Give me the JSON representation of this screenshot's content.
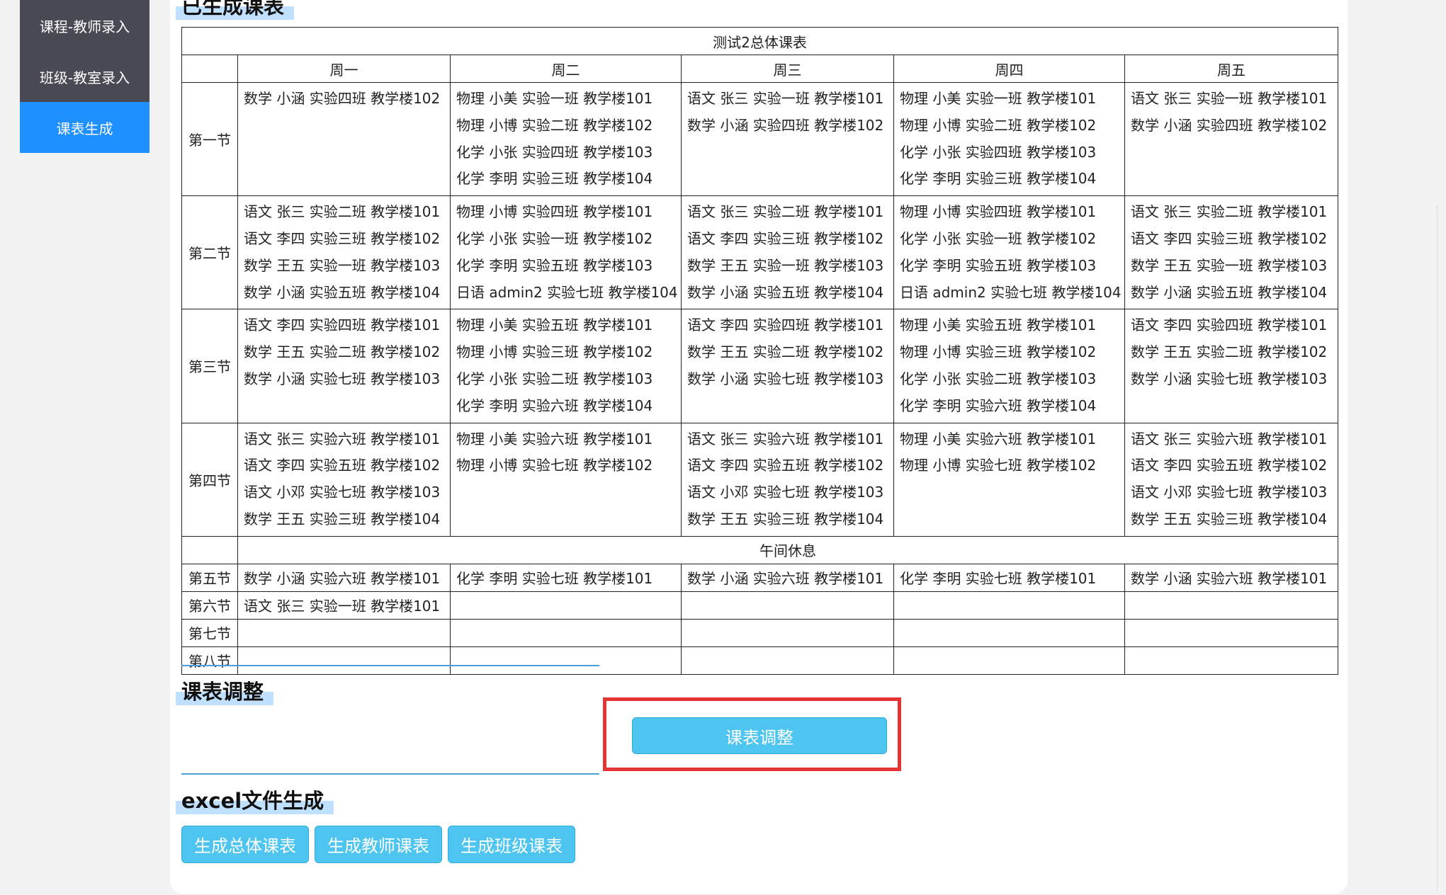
{
  "sidebar": {
    "items": [
      {
        "label": "课程-教师录入"
      },
      {
        "label": "班级-教室录入"
      },
      {
        "label": "课表生成"
      }
    ]
  },
  "generated": {
    "title": "已生成课表",
    "table_title": "测试2总体课表",
    "days": [
      "周一",
      "周二",
      "周三",
      "周四",
      "周五"
    ],
    "lunch_break": "午间休息",
    "morning": [
      {
        "period": "第一节",
        "cells": [
          [
            "数学 小涵 实验四班 教学楼102"
          ],
          [
            "物理 小美 实验一班 教学楼101",
            "物理 小博 实验二班 教学楼102",
            "化学 小张 实验四班 教学楼103",
            "化学 李明 实验三班 教学楼104"
          ],
          [
            "语文 张三 实验一班 教学楼101",
            "数学 小涵 实验四班 教学楼102"
          ],
          [
            "物理 小美 实验一班 教学楼101",
            "物理 小博 实验二班 教学楼102",
            "化学 小张 实验四班 教学楼103",
            "化学 李明 实验三班 教学楼104"
          ],
          [
            "语文 张三 实验一班 教学楼101",
            "数学 小涵 实验四班 教学楼102"
          ]
        ]
      },
      {
        "period": "第二节",
        "cells": [
          [
            "语文 张三 实验二班 教学楼101",
            "语文 李四 实验三班 教学楼102",
            "数学 王五 实验一班 教学楼103",
            "数学 小涵 实验五班 教学楼104"
          ],
          [
            "物理 小博 实验四班 教学楼101",
            "化学 小张 实验一班 教学楼102",
            "化学 李明 实验五班 教学楼103",
            "日语 admin2 实验七班 教学楼104"
          ],
          [
            "语文 张三 实验二班 教学楼101",
            "语文 李四 实验三班 教学楼102",
            "数学 王五 实验一班 教学楼103",
            "数学 小涵 实验五班 教学楼104"
          ],
          [
            "物理 小博 实验四班 教学楼101",
            "化学 小张 实验一班 教学楼102",
            "化学 李明 实验五班 教学楼103",
            "日语 admin2 实验七班 教学楼104"
          ],
          [
            "语文 张三 实验二班 教学楼101",
            "语文 李四 实验三班 教学楼102",
            "数学 王五 实验一班 教学楼103",
            "数学 小涵 实验五班 教学楼104"
          ]
        ]
      },
      {
        "period": "第三节",
        "cells": [
          [
            "语文 李四 实验四班 教学楼101",
            "数学 王五 实验二班 教学楼102",
            "数学 小涵 实验七班 教学楼103"
          ],
          [
            "物理 小美 实验五班 教学楼101",
            "物理 小博 实验三班 教学楼102",
            "化学 小张 实验二班 教学楼103",
            "化学 李明 实验六班 教学楼104"
          ],
          [
            "语文 李四 实验四班 教学楼101",
            "数学 王五 实验二班 教学楼102",
            "数学 小涵 实验七班 教学楼103"
          ],
          [
            "物理 小美 实验五班 教学楼101",
            "物理 小博 实验三班 教学楼102",
            "化学 小张 实验二班 教学楼103",
            "化学 李明 实验六班 教学楼104"
          ],
          [
            "语文 李四 实验四班 教学楼101",
            "数学 王五 实验二班 教学楼102",
            "数学 小涵 实验七班 教学楼103"
          ]
        ]
      },
      {
        "period": "第四节",
        "cells": [
          [
            "语文 张三 实验六班 教学楼101",
            "语文 李四 实验五班 教学楼102",
            "语文 小邓 实验七班 教学楼103",
            "数学 王五 实验三班 教学楼104"
          ],
          [
            "物理 小美 实验六班 教学楼101",
            "物理 小博 实验七班 教学楼102"
          ],
          [
            "语文 张三 实验六班 教学楼101",
            "语文 李四 实验五班 教学楼102",
            "语文 小邓 实验七班 教学楼103",
            "数学 王五 实验三班 教学楼104"
          ],
          [
            "物理 小美 实验六班 教学楼101",
            "物理 小博 实验七班 教学楼102"
          ],
          [
            "语文 张三 实验六班 教学楼101",
            "语文 李四 实验五班 教学楼102",
            "语文 小邓 实验七班 教学楼103",
            "数学 王五 实验三班 教学楼104"
          ]
        ]
      }
    ],
    "afternoon": [
      {
        "period": "第五节",
        "cells": [
          "数学 小涵 实验六班 教学楼101",
          "化学 李明 实验七班 教学楼101",
          "数学 小涵 实验六班 教学楼101",
          "化学 李明 实验七班 教学楼101",
          "数学 小涵 实验六班 教学楼101"
        ]
      },
      {
        "period": "第六节",
        "cells": [
          "语文 张三 实验一班 教学楼101",
          "",
          "",
          "",
          ""
        ]
      },
      {
        "period": "第七节",
        "cells": [
          "",
          "",
          "",
          "",
          ""
        ]
      },
      {
        "period": "第八节",
        "cells": [
          "",
          "",
          "",
          "",
          ""
        ]
      }
    ]
  },
  "adjust": {
    "title": "课表调整",
    "button_label": "课表调整"
  },
  "excel": {
    "title": "excel文件生成",
    "buttons": [
      "生成总体课表",
      "生成教师课表",
      "生成班级课表"
    ]
  }
}
